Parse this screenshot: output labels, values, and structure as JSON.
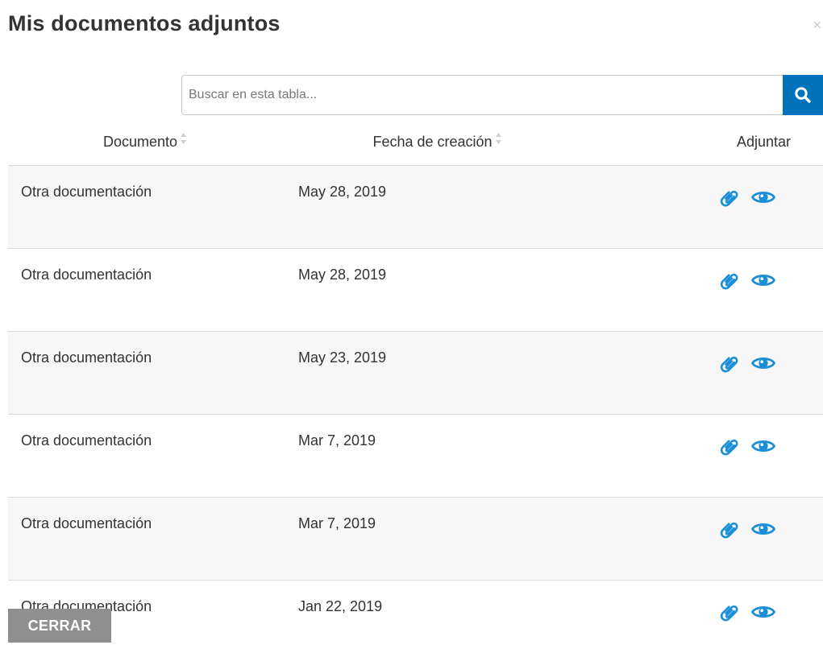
{
  "modal": {
    "title": "Mis documentos adjuntos",
    "close_glyph": "×"
  },
  "search": {
    "placeholder": "Buscar en esta tabla...",
    "icon": "search-icon"
  },
  "table": {
    "columns": [
      {
        "label": "Documento",
        "sortable": true
      },
      {
        "label": "Fecha de creación",
        "sortable": true
      },
      {
        "label": "Adjuntar",
        "sortable": false
      }
    ],
    "rows": [
      {
        "documento": "Otra documentación",
        "fecha": "May 28, 2019"
      },
      {
        "documento": "Otra documentación",
        "fecha": "May 28, 2019"
      },
      {
        "documento": "Otra documentación",
        "fecha": "May 23, 2019"
      },
      {
        "documento": "Otra documentación",
        "fecha": "Mar 7, 2019"
      },
      {
        "documento": "Otra documentación",
        "fecha": "Mar 7, 2019"
      },
      {
        "documento": "Otra documentación",
        "fecha": "Jan 22, 2019"
      }
    ],
    "row_icons": [
      "paperclip-icon",
      "eye-icon"
    ]
  },
  "footer": {
    "close_label": "CERRAR"
  },
  "colors": {
    "accent": "#0072bb",
    "icon": "#1a8fd6",
    "close_button_bg": "#8f8f8f",
    "row_stripe": "#f7f7f7"
  }
}
